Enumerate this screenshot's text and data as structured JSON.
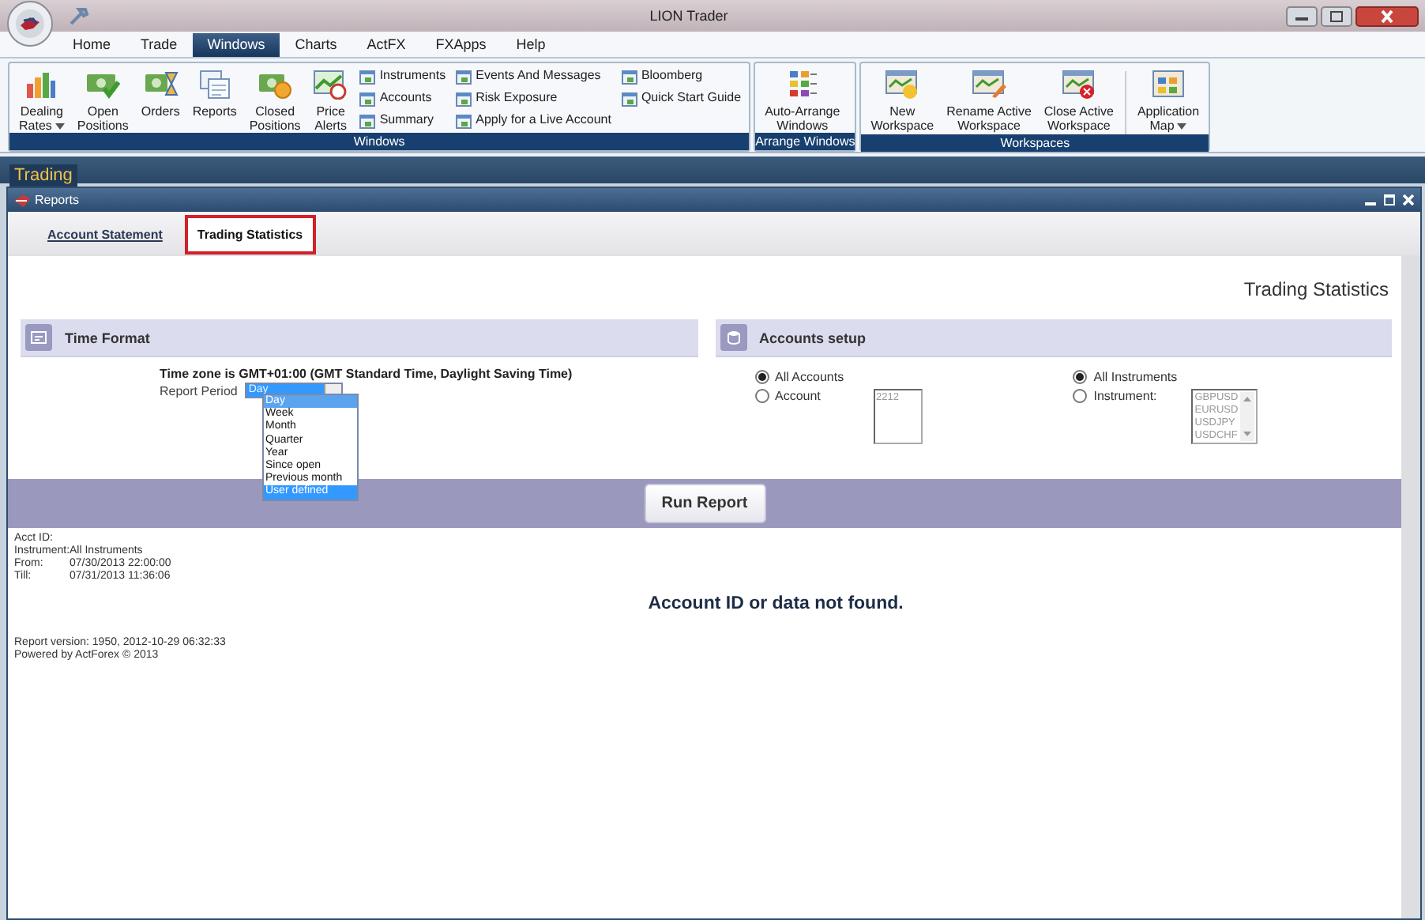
{
  "window": {
    "title": "LION Trader"
  },
  "menu_tabs": [
    {
      "label": "Home",
      "selected": false
    },
    {
      "label": "Trade",
      "selected": false
    },
    {
      "label": "Windows",
      "selected": true
    },
    {
      "label": "Charts",
      "selected": false
    },
    {
      "label": "ActFX",
      "selected": false
    },
    {
      "label": "FXApps",
      "selected": false
    },
    {
      "label": "Help",
      "selected": false
    }
  ],
  "ribbon_groups": [
    {
      "label": "Windows",
      "items": [
        {
          "kind": "large",
          "label": "Dealing\nRates",
          "has_menu": true
        },
        {
          "kind": "large",
          "label": "Open\nPositions",
          "has_menu": false
        },
        {
          "kind": "large",
          "label": "Orders",
          "has_menu": false
        },
        {
          "kind": "large",
          "label": "Reports",
          "has_menu": false
        },
        {
          "kind": "large",
          "label": "Closed\nPositions",
          "has_menu": false
        },
        {
          "kind": "large",
          "label": "Price\nAlerts",
          "has_menu": false
        },
        {
          "kind": "stack",
          "entries": [
            "Instruments",
            "Accounts",
            "Summary"
          ]
        },
        {
          "kind": "stack",
          "entries": [
            "Events And Messages",
            "Risk Exposure",
            "Apply for a Live Account"
          ]
        },
        {
          "kind": "stack",
          "entries": [
            "Bloomberg",
            "Quick Start Guide"
          ]
        }
      ]
    },
    {
      "label": "Arrange Windows",
      "items": [
        {
          "kind": "large",
          "label": "Auto-Arrange\nWindows",
          "has_menu": false
        }
      ]
    },
    {
      "label": "Workspaces",
      "items": [
        {
          "kind": "large",
          "label": "New\nWorkspace",
          "has_menu": false
        },
        {
          "kind": "large",
          "label": "Rename Active\nWorkspace",
          "has_menu": false
        },
        {
          "kind": "large",
          "label": "Close Active\nWorkspace",
          "has_menu": false
        },
        {
          "kind": "separator"
        },
        {
          "kind": "large",
          "label": "Application\nMap",
          "has_menu": true
        }
      ]
    }
  ],
  "workspace_tab": "Trading",
  "panel": {
    "title": "Reports"
  },
  "report_tabs": [
    {
      "label": "Account Statement",
      "selected": false
    },
    {
      "label": "Trading Statistics",
      "selected": true
    }
  ],
  "page_heading": "Trading Statistics",
  "time_format": {
    "title": "Time Format",
    "timezone": "Time zone is GMT+01:00 (GMT Standard Time, Daylight Saving Time)",
    "period_label": "Report Period",
    "period_value": "Day",
    "expanded": true,
    "period_options": [
      {
        "label": "Day",
        "selected": true,
        "hovered": false
      },
      {
        "label": "Week",
        "selected": false,
        "hovered": false
      },
      {
        "label": "Month",
        "selected": false,
        "hovered": false
      },
      {
        "label": "Quarter",
        "selected": false,
        "hovered": false
      },
      {
        "label": "Year",
        "selected": false,
        "hovered": false
      },
      {
        "label": "Since open",
        "selected": false,
        "hovered": false
      },
      {
        "label": "Previous month",
        "selected": false,
        "hovered": false
      },
      {
        "label": "User defined",
        "selected": false,
        "hovered": true
      }
    ]
  },
  "accounts_setup": {
    "title": "Accounts setup",
    "account_choices": [
      {
        "label": "All Accounts",
        "selected": true
      },
      {
        "label": "Account",
        "selected": false,
        "list": [
          "2212"
        ]
      }
    ],
    "instrument_choices": [
      {
        "label": "All Instruments",
        "selected": true
      },
      {
        "label": "Instrument:",
        "selected": false,
        "list": [
          "GBPUSD",
          "EURUSD",
          "USDJPY",
          "USDCHF"
        ]
      }
    ]
  },
  "run_button": "Run Report",
  "report": {
    "fields": [
      {
        "label": "Acct ID:"
      },
      {
        "label": "Instrument:",
        "value": "All Instruments"
      },
      {
        "label": "From:",
        "value": "07/30/2013 22:00:00"
      },
      {
        "label": "Till:",
        "value": "07/31/2013 11:36:06"
      }
    ],
    "message": "Account ID or data not found.",
    "footer": [
      "Report version: 1950, 2012-10-29 06:32:33",
      "Powered by ActForex © 2013"
    ]
  }
}
